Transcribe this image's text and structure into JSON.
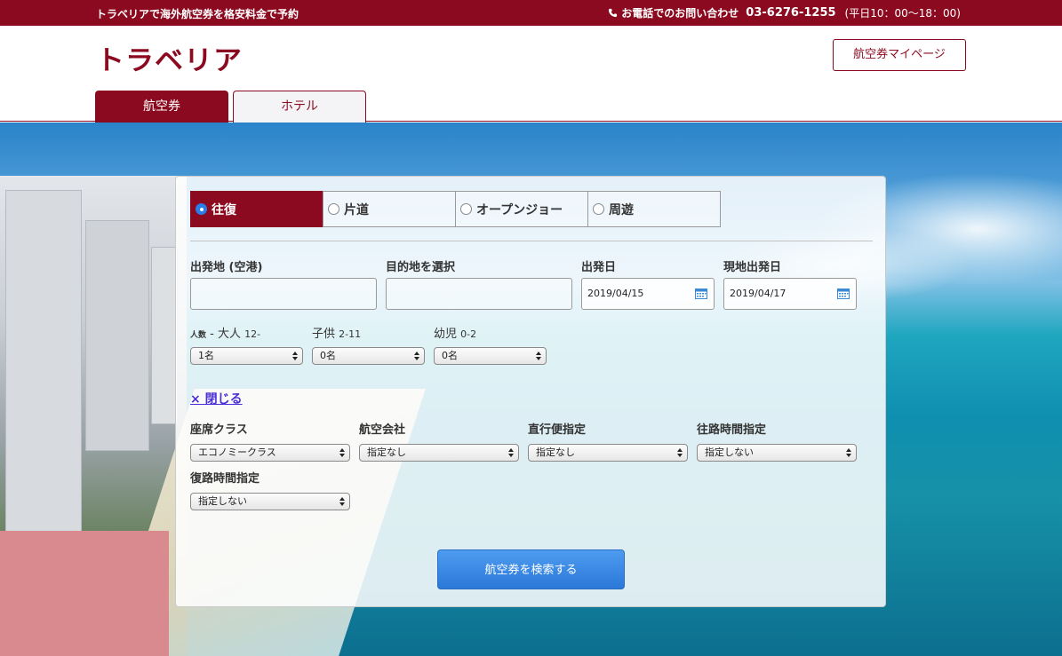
{
  "topbar": {
    "tagline": "トラベリアで海外航空券を格安料金で予約",
    "contact_label": "お電話でのお問い合わせ",
    "phone": "03-6276-1255",
    "hours": "(平日10：00〜18：00)"
  },
  "header": {
    "logo": "トラベリア",
    "mypage_label": "航空券マイページ",
    "tabs": [
      {
        "label": "航空券",
        "active": true
      },
      {
        "label": "ホテル",
        "active": false
      }
    ]
  },
  "search": {
    "trip_types": [
      {
        "label": "往復",
        "checked": true
      },
      {
        "label": "片道",
        "checked": false
      },
      {
        "label": "オープンジョー",
        "checked": false
      },
      {
        "label": "周遊",
        "checked": false
      }
    ],
    "origin_label": "出発地 (空港)",
    "origin_value": "",
    "destination_label": "目的地を選択",
    "destination_value": "",
    "depart_label": "出発日",
    "depart_value": "2019/04/15",
    "return_label": "現地出発日",
    "return_value": "2019/04/17",
    "pax": {
      "prefix": "人数",
      "adult_label": "大人",
      "adult_range": "12-",
      "adult_value": "1名",
      "child_label": "子供",
      "child_range": "2-11",
      "child_value": "0名",
      "infant_label": "幼児",
      "infant_range": "0-2",
      "infant_value": "0名"
    },
    "close_label": "× 閉じる",
    "options": {
      "seat_class_label": "座席クラス",
      "seat_class_value": "エコノミークラス",
      "airline_label": "航空会社",
      "airline_value": "指定なし",
      "nonstop_label": "直行便指定",
      "nonstop_value": "指定なし",
      "outbound_time_label": "往路時間指定",
      "outbound_time_value": "指定しない",
      "return_time_label": "復路時間指定",
      "return_time_value": "指定しない"
    },
    "submit_label": "航空券を検索する"
  },
  "colors": {
    "brand": "#8b0a1f",
    "button_blue": "#2b78d8",
    "link": "#4a2fd6"
  }
}
